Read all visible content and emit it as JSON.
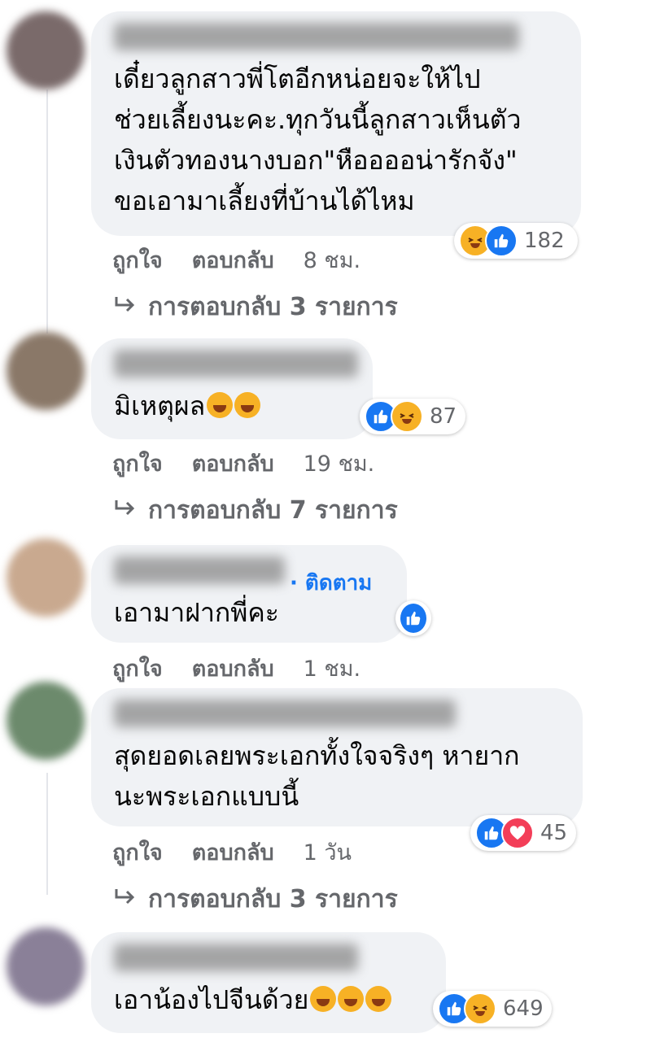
{
  "comments": [
    {
      "text": "เดี๋ยวลูกสาวพี่โตอีกหน่อยจะให้ไป\nช่วยเลี้ยงนะคะ.ทุกวันนี้ลูกสาวเห็นตัว\nเงินตัวทองนางบอก\"หืออออน่ารักจัง\"\nขอเอามาเลี้ยงที่บ้านได้ไหม",
      "reaction_count": "182",
      "reaction_icons": [
        "haha-icon",
        "like-icon"
      ],
      "like_label": "ถูกใจ",
      "reply_label": "ตอบกลับ",
      "time": "8 ชม.",
      "view_replies": "การตอบกลับ 3 รายการ"
    },
    {
      "text": "มิเหตุผล",
      "inline_emoji": [
        "rofl-emoji",
        "rofl-emoji"
      ],
      "reaction_count": "87",
      "reaction_icons": [
        "like-icon",
        "haha-icon"
      ],
      "like_label": "ถูกใจ",
      "reply_label": "ตอบกลับ",
      "time": "19 ชม.",
      "view_replies": "การตอบกลับ 7 รายการ"
    },
    {
      "follow_label": "· ติดตาม",
      "text": "เอามาฝากพี่คะ",
      "reaction_icons": [
        "like-icon"
      ],
      "like_label": "ถูกใจ",
      "reply_label": "ตอบกลับ",
      "time": "1 ชม."
    },
    {
      "text": "สุดยอดเลยพระเอกทั้งใจจริงๆ หายาก\nนะพระเอกแบบนี้",
      "reaction_count": "45",
      "reaction_icons": [
        "like-icon",
        "love-icon"
      ],
      "like_label": "ถูกใจ",
      "reply_label": "ตอบกลับ",
      "time": "1 วัน",
      "view_replies": "การตอบกลับ 3 รายการ"
    },
    {
      "text": "เอาน้องไปจีนด้วย",
      "inline_emoji": [
        "joy-emoji",
        "joy-emoji",
        "joy-emoji"
      ],
      "reaction_count": "649",
      "reaction_icons": [
        "like-icon",
        "haha-icon"
      ]
    }
  ],
  "colors": {
    "bubble": "#f0f2f5",
    "like": "#1877f2",
    "love": "#f33e58",
    "haha": "#f7b125",
    "meta": "#65676b"
  }
}
